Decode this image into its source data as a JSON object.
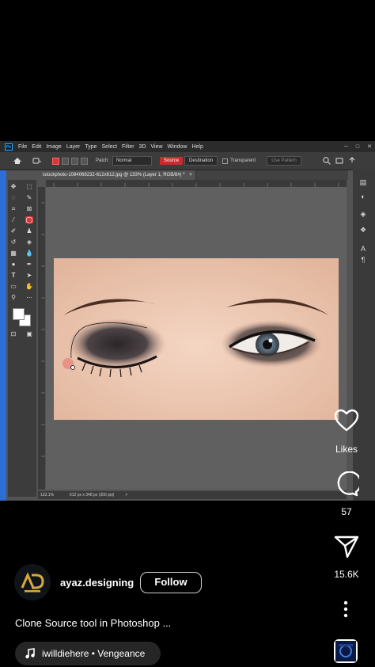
{
  "photoshop": {
    "menu": [
      "File",
      "Edit",
      "Image",
      "Layer",
      "Type",
      "Select",
      "Filter",
      "3D",
      "View",
      "Window",
      "Help"
    ],
    "logo": "Ps",
    "window_controls": [
      "─",
      "□",
      "✕"
    ],
    "options": {
      "patch_label": "Patch:",
      "patch_value": "Normal",
      "source": "Source",
      "destination": "Destination",
      "transparent": "Transparent",
      "use_pattern": "Use Pattern"
    },
    "tab_title": "istockphoto-1084068232-612x612.jpg @ 133% (Layer 1, RGB/8#) *",
    "tab_close": "×",
    "status_zoom": "133.1%",
    "status_info": "612 px x 348 px (300 ppi)",
    "status_arrow": ">"
  },
  "reel": {
    "likes_label": "Likes",
    "comments_count": "57",
    "shares_count": "15.6K",
    "username": "ayaz.designing",
    "follow_label": "Follow",
    "caption": "Clone Source tool in Photoshop ...",
    "audio": "iwilldiehere • Vengeance",
    "colors": {
      "background": "#000000",
      "accent_red": "#d43a3a",
      "audio_pill": "#262626"
    },
    "icons": [
      "heart-icon",
      "comment-icon",
      "share-icon",
      "more-icon",
      "music-note-icon"
    ]
  }
}
